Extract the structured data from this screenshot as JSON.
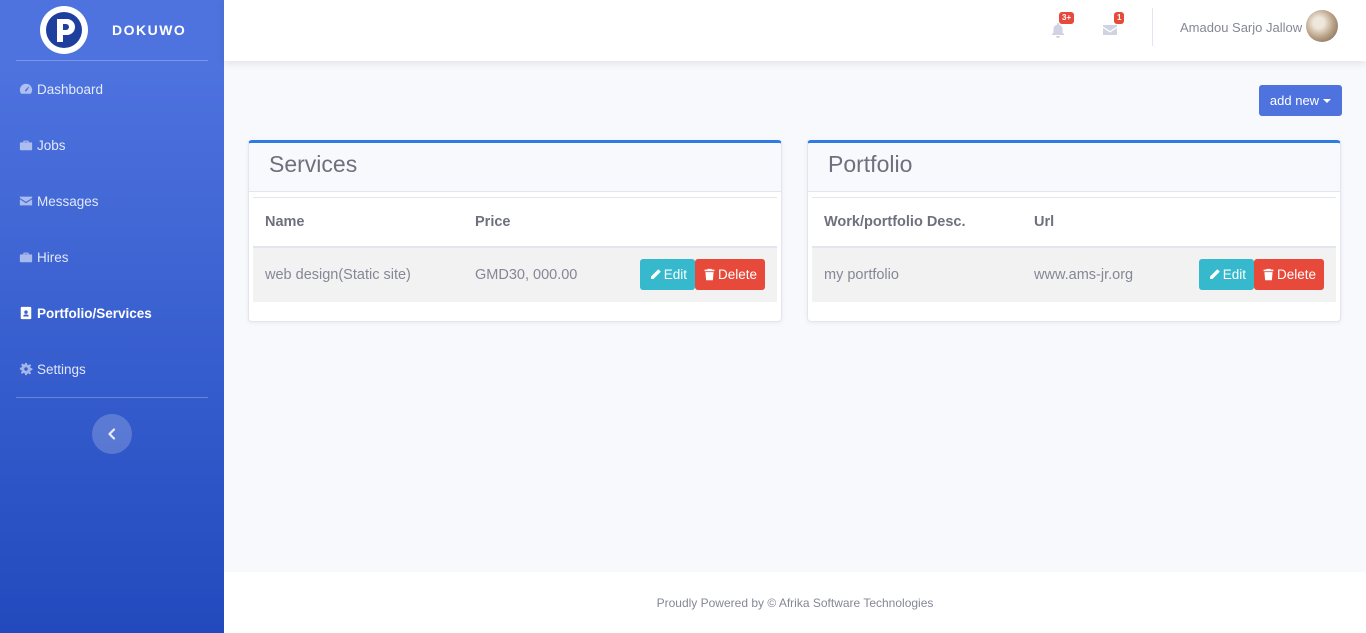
{
  "brand": {
    "name": "DOKUWO",
    "logo_icon": "dokuwo-logo-icon"
  },
  "sidebar": {
    "items": [
      {
        "label": "Dashboard",
        "icon": "tachometer-icon",
        "active": false
      },
      {
        "label": "Jobs",
        "icon": "briefcase-icon",
        "active": false
      },
      {
        "label": "Messages",
        "icon": "envelope-icon",
        "active": false
      },
      {
        "label": "Hires",
        "icon": "briefcase-icon",
        "active": false
      },
      {
        "label": "Portfolio/Services",
        "icon": "id-badge-icon",
        "active": true
      },
      {
        "label": "Settings",
        "icon": "cog-icon",
        "active": false
      }
    ]
  },
  "topbar": {
    "alerts_badge": "3+",
    "messages_badge": "1",
    "user_name": "Amadou Sarjo Jallow"
  },
  "content": {
    "add_button_label": "add new"
  },
  "services": {
    "title": "Services",
    "columns": [
      "Name",
      "Price"
    ],
    "rows": [
      {
        "name": "web design(Static site)",
        "price": "GMD30, 000.00"
      }
    ]
  },
  "portfolio": {
    "title": "Portfolio",
    "columns": [
      "Work/portfolio Desc.",
      "Url"
    ],
    "rows": [
      {
        "desc": "my portfolio",
        "url": "www.ams-jr.org"
      }
    ]
  },
  "actions": {
    "edit_label": "Edit",
    "delete_label": "Delete"
  },
  "footer": {
    "text": "Proudly Powered by © Afrika Software Technologies"
  },
  "colors": {
    "primary": "#4e73df",
    "info": "#36b9cc",
    "danger": "#e74a3b",
    "card_accent": "#2e7be4"
  }
}
